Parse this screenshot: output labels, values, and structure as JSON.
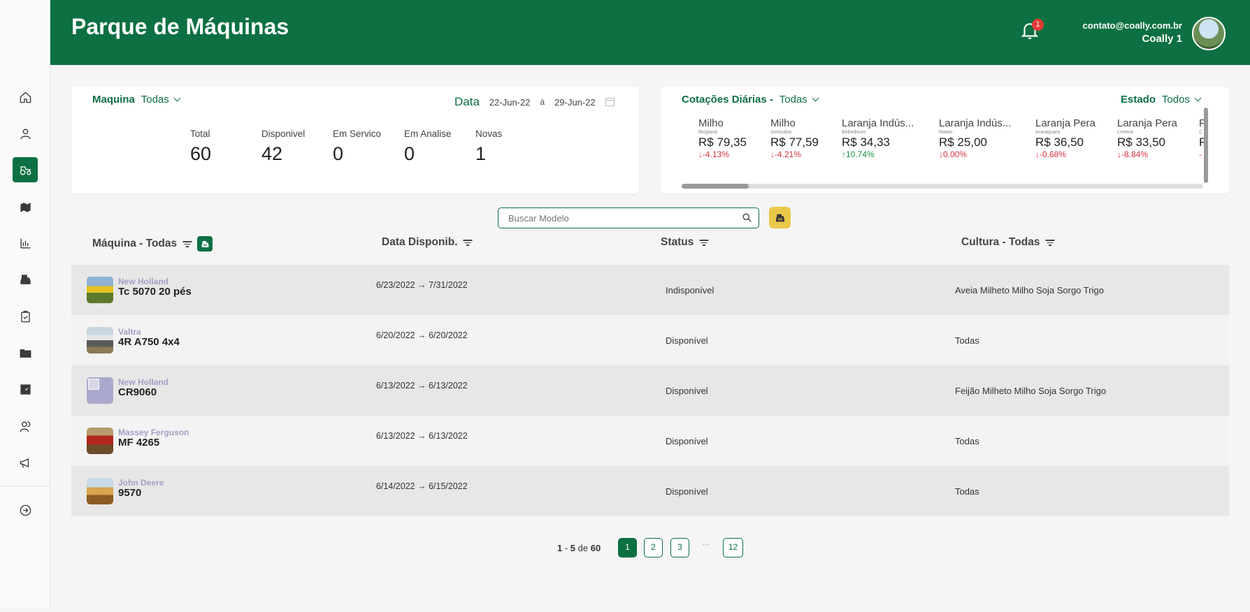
{
  "header": {
    "title": "Parque de Máquinas",
    "notifications": "1",
    "user_email": "contato@coally.com.br",
    "user_name": "Coally 1"
  },
  "sidebar": {
    "items": [
      "home-icon",
      "user-icon",
      "tractor-icon",
      "map-icon",
      "chart-icon",
      "register-icon",
      "clipboard-icon",
      "folder-icon",
      "image-chart-icon",
      "users-icon",
      "megaphone-icon",
      "exit-icon"
    ],
    "active": "tractor-icon"
  },
  "machine_filter": {
    "label": "Maquina",
    "value": "Todas"
  },
  "date_filter": {
    "label": "Data",
    "from": "22-Jun-22",
    "sep": "à",
    "to": "29-Jun-22"
  },
  "stats": [
    {
      "label": "Total",
      "value": "60"
    },
    {
      "label": "Disponivel",
      "value": "42"
    },
    {
      "label": "Em Servico",
      "value": "0"
    },
    {
      "label": "Em Analise",
      "value": "0"
    },
    {
      "label": "Novas",
      "value": "1"
    }
  ],
  "quotes_filter": {
    "label": "Cotações Diárias -",
    "value": "Todas"
  },
  "state_filter": {
    "label": "Estado",
    "value": "Todos"
  },
  "quotes": [
    {
      "name": "Milho",
      "place": "Mogiana",
      "price": "R$ 79,35",
      "change": "-4.13%",
      "dir": "down"
    },
    {
      "name": "Milho",
      "place": "Sorocaba",
      "price": "R$ 77,59",
      "change": "-4.21%",
      "dir": "down"
    },
    {
      "name": "Laranja Indús...",
      "place": "Bebedouro",
      "price": "R$ 34,33",
      "change": "10.74%",
      "dir": "up"
    },
    {
      "name": "Laranja Indús...",
      "place": "Matao",
      "price": "R$ 25,00",
      "change": "0.00%",
      "dir": "down"
    },
    {
      "name": "Laranja Pera",
      "place": "Araraquara",
      "price": "R$ 36,50",
      "change": "-0.68%",
      "dir": "down"
    },
    {
      "name": "Laranja Pera",
      "place": "Limeira",
      "price": "R$ 33,50",
      "change": "-8.84%",
      "dir": "down"
    },
    {
      "name": "F",
      "place": "C",
      "price": "F",
      "change": "-",
      "dir": "down"
    }
  ],
  "search": {
    "placeholder": "Buscar Modelo"
  },
  "table": {
    "headers": {
      "machine": "Máquina - Todas",
      "date": "Data Disponib.",
      "status": "Status",
      "culture": "Cultura - Todas"
    },
    "rows": [
      {
        "brand": "New Holland",
        "model": "Tc 5070 20 pés",
        "start": "6/23/2022",
        "end": "7/31/2022",
        "status": "Indisponível",
        "culture": "Aveia Milheto Milho Soja Sorgo Trigo",
        "img": "harvester"
      },
      {
        "brand": "Valtra",
        "model": "4R A750 4x4",
        "start": "6/20/2022",
        "end": "6/20/2022",
        "status": "Disponível",
        "culture": "Todas",
        "img": "tractor"
      },
      {
        "brand": "New Holland",
        "model": "CR9060",
        "start": "6/13/2022",
        "end": "6/13/2022",
        "status": "Disponível",
        "culture": "Feijão Milheto Milho Soja Sorgo Trigo",
        "img": "placeholder"
      },
      {
        "brand": "Massey Ferguson",
        "model": "MF 4265",
        "start": "6/13/2022",
        "end": "6/13/2022",
        "status": "Disponível",
        "culture": "Todas",
        "img": "red-tractor"
      },
      {
        "brand": "John Deere",
        "model": "9570",
        "start": "6/14/2022",
        "end": "6/15/2022",
        "status": "Disponível",
        "culture": "Todas",
        "img": "field"
      }
    ]
  },
  "pagination": {
    "range_start": "1",
    "range_end": "5",
    "of": "de",
    "total": "60",
    "pages": [
      "1",
      "2",
      "3",
      "12"
    ],
    "active": "1",
    "ellipsis": "···"
  },
  "colors": {
    "brand_green": "#0c7042",
    "accent_yellow": "#eac84a",
    "negative": "#d9303e",
    "positive": "#1e8f3e",
    "brand_text": "#a3a0c5"
  }
}
